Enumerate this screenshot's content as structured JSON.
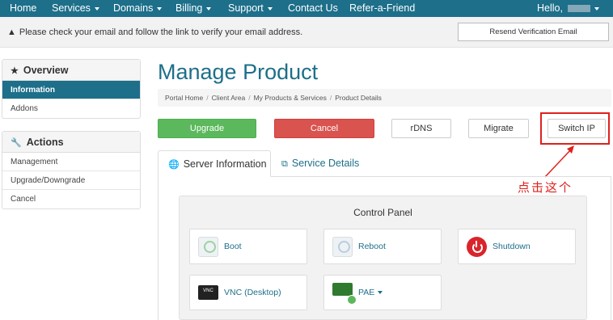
{
  "nav": {
    "items": [
      "Home",
      "Services",
      "Domains",
      "Billing",
      "Support",
      "Contact Us",
      "Refer-a-Friend"
    ],
    "hello": "Hello,"
  },
  "alert": {
    "message": "Please check your email and follow the link to verify your email address.",
    "resend_button": "Resend Verification Email"
  },
  "sidebar": {
    "overview_title": "Overview",
    "overview_items": [
      "Information",
      "Addons"
    ],
    "actions_title": "Actions",
    "action_items": [
      "Management",
      "Upgrade/Downgrade",
      "Cancel"
    ]
  },
  "page": {
    "title": "Manage Product",
    "breadcrumb": [
      "Portal Home",
      "Client Area",
      "My Products & Services",
      "Product Details"
    ]
  },
  "buttons": {
    "upgrade": "Upgrade",
    "cancel": "Cancel",
    "rdns": "rDNS",
    "migrate": "Migrate",
    "switch_ip": "Switch IP"
  },
  "annotation": {
    "text": "点击这个",
    "color": "#e0201c"
  },
  "tabs": [
    "Server Information",
    "Service Details"
  ],
  "control_panel": {
    "title": "Control Panel",
    "tiles": [
      "Boot",
      "Reboot",
      "Shutdown",
      "VNC (Desktop)",
      "PAE"
    ],
    "vnc_icon_text": "VNC"
  },
  "colors": {
    "brand": "#1d6f8a",
    "success": "#5cb85c",
    "danger": "#d9534f"
  }
}
